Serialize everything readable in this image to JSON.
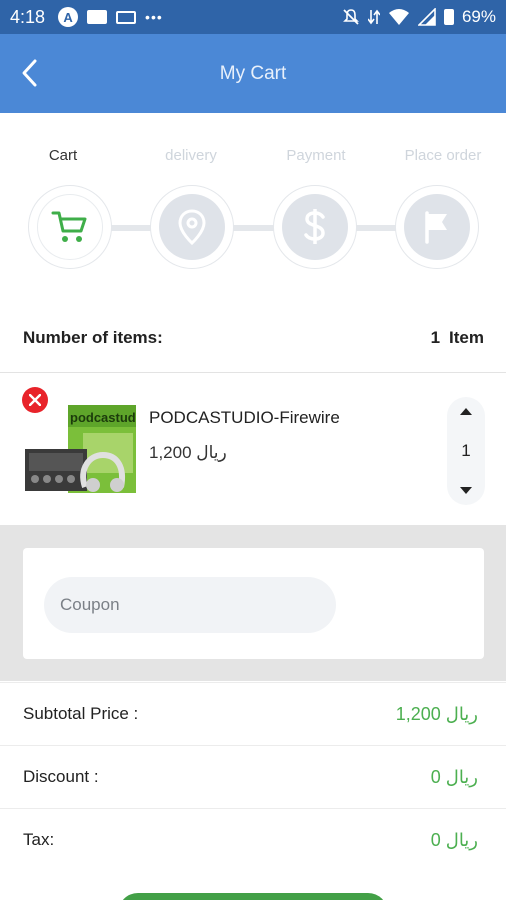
{
  "status_bar": {
    "time": "4:18",
    "battery": "69%",
    "icons": [
      "a-circle-icon",
      "card-icon",
      "laptop-icon",
      "more-dots-icon",
      "mute-icon",
      "data-arrows-icon",
      "wifi-icon",
      "signal-icon",
      "battery-icon"
    ]
  },
  "app_bar": {
    "title": "My Cart",
    "back_icon": "chevron-left-icon"
  },
  "steps": [
    {
      "label": "Cart",
      "icon": "cart-icon",
      "active": true
    },
    {
      "label": "delivery",
      "icon": "location-pin-icon",
      "active": false
    },
    {
      "label": "Payment",
      "icon": "dollar-icon",
      "active": false
    },
    {
      "label": "Place order",
      "icon": "flag-icon",
      "active": false
    }
  ],
  "items": {
    "label": "Number of items:",
    "count": "1",
    "unit": "Item"
  },
  "product": {
    "name": "PODCASTUDIO-Firewire",
    "price": "ريال 1,200",
    "quantity": "1",
    "remove_icon": "close-icon"
  },
  "coupon": {
    "placeholder": "Coupon"
  },
  "totals": [
    {
      "label": "Subtotal Price :",
      "value": "ريال 1,200"
    },
    {
      "label": "Discount :",
      "value": "ريال 0"
    },
    {
      "label": "Tax:",
      "value": "ريال 0"
    }
  ],
  "colors": {
    "status_bar": "#2f64a8",
    "app_bar": "#4b88d6",
    "accent_green": "#4caf50",
    "remove_red": "#e8232a"
  }
}
